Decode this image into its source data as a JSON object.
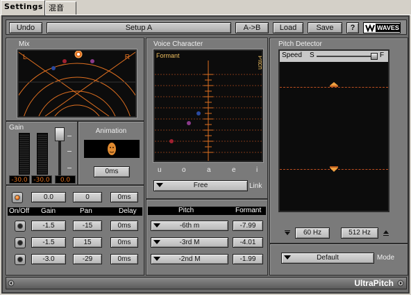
{
  "tabs": [
    {
      "label": "Settings"
    },
    {
      "label": "混音"
    }
  ],
  "toolbar": {
    "undo": "Undo",
    "setup": "Setup A",
    "ab": "A->B",
    "load": "Load",
    "save": "Save",
    "help": "?",
    "logo": "WAVES"
  },
  "mix": {
    "title": "Mix",
    "left": "L",
    "right": "R"
  },
  "gain": {
    "title": "Gain",
    "meter_left": "-30.0",
    "meter_right": "-30.0",
    "fader_value": "0.0"
  },
  "animation": {
    "title": "Animation",
    "time": "0ms"
  },
  "voice_character": {
    "title": "Voice Character",
    "formant_label": "Formant",
    "pitch_label": "Pitch",
    "vowels": [
      "u",
      "o",
      "a",
      "e",
      "i"
    ],
    "mode": "Free",
    "link": "Link"
  },
  "pitch_detector": {
    "title": "Pitch Detector",
    "speed": "Speed",
    "slow": "S",
    "fast": "F",
    "low_hz": "60 Hz",
    "high_hz": "512 Hz",
    "preset": "Default",
    "mode": "Mode"
  },
  "voices": {
    "master": {
      "gain": "0.0",
      "pan": "0",
      "delay": "0ms"
    },
    "headers": {
      "onoff": "On/Off",
      "gain": "Gain",
      "pan": "Pan",
      "delay": "Delay",
      "pitch": "Pitch",
      "formant": "Formant"
    },
    "rows": [
      {
        "gain": "-1.5",
        "pan": "-15",
        "delay": "0ms",
        "pitch": "-6th m",
        "formant": "-7.99"
      },
      {
        "gain": "-1.5",
        "pan": "15",
        "delay": "0ms",
        "pitch": "-3rd M",
        "formant": "-4.01"
      },
      {
        "gain": "-3.0",
        "pan": "-29",
        "delay": "0ms",
        "pitch": "-2nd M",
        "formant": "-1.99"
      }
    ]
  },
  "footer": {
    "product": "UltraPitch"
  },
  "colors": {
    "accent": "#e07020",
    "screen": "#0c0c0c",
    "plate": "#7a7a7a"
  }
}
